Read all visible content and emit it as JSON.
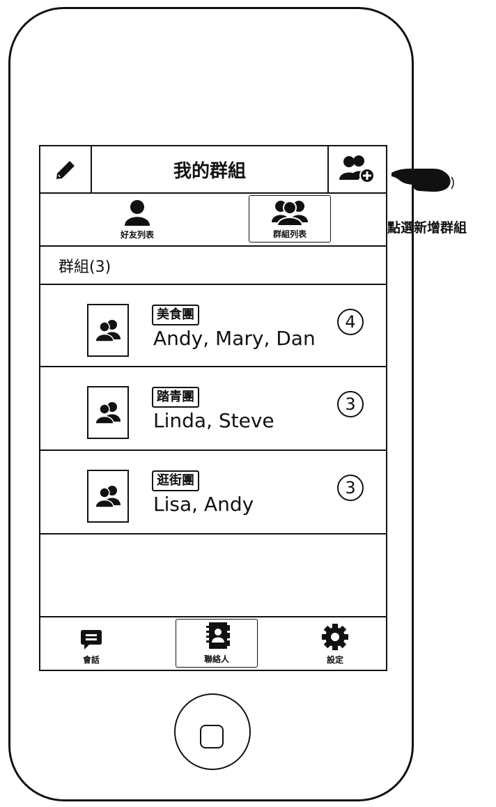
{
  "header": {
    "title": "我的群組"
  },
  "segments": [
    {
      "label": "好友列表",
      "icon": "person-icon"
    },
    {
      "label": "群組列表",
      "icon": "group-icon"
    }
  ],
  "section": {
    "label": "群組(3)"
  },
  "groups": [
    {
      "name": "美食團",
      "members": "Andy, Mary, Dan",
      "count": "4"
    },
    {
      "name": "踏青團",
      "members": "Linda, Steve",
      "count": "3"
    },
    {
      "name": "逛街團",
      "members": "Lisa, Andy",
      "count": "3"
    }
  ],
  "tabbar": [
    {
      "label": "會話",
      "icon": "chat-icon"
    },
    {
      "label": "聯絡人",
      "icon": "contacts-icon"
    },
    {
      "label": "設定",
      "icon": "gear-icon"
    }
  ],
  "annotation": {
    "text": "點選新增群組"
  }
}
